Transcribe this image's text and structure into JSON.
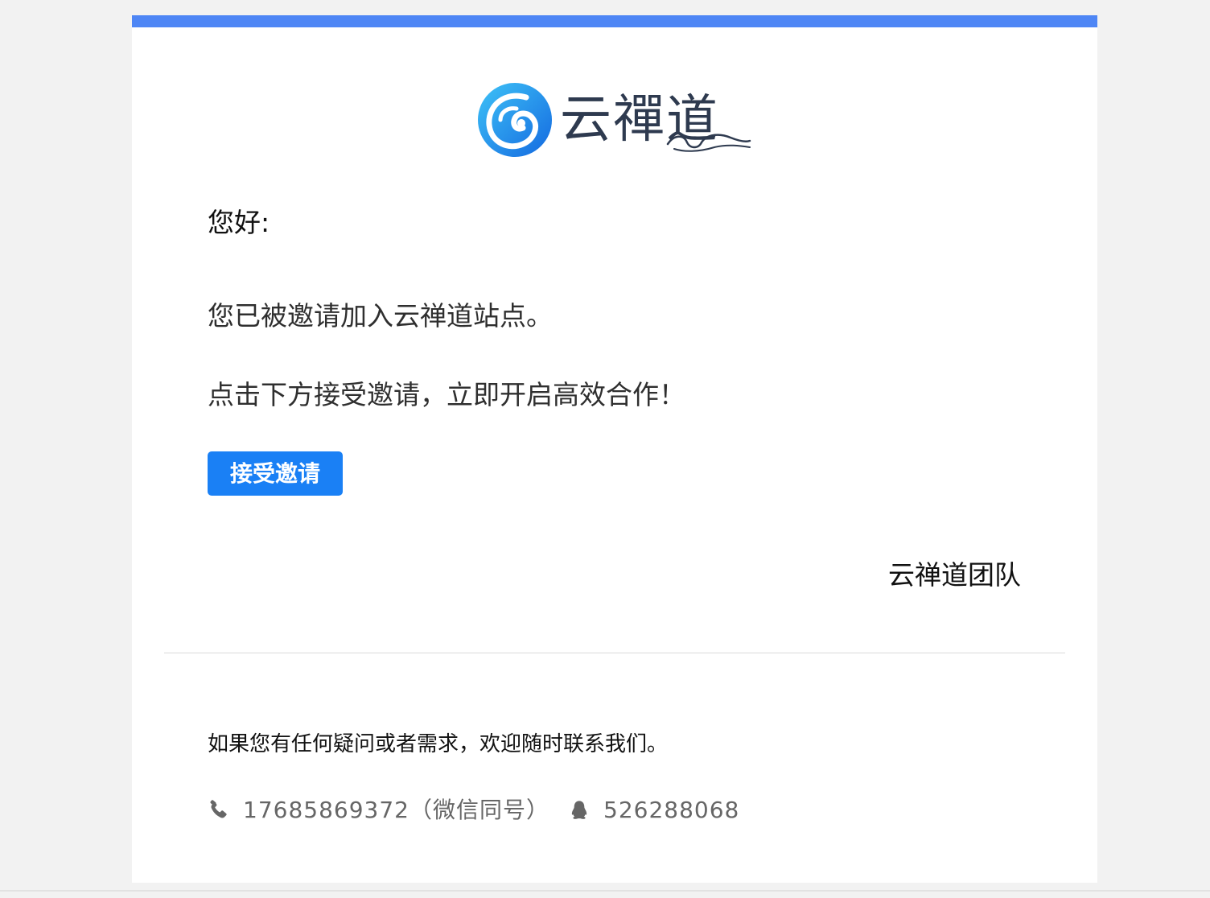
{
  "colors": {
    "accent_bar": "#4e86f5",
    "button": "#1a80f5",
    "logo_text": "#2e3a4f"
  },
  "logo": {
    "text": "云禪道",
    "icon": "yunchandao-logo-icon"
  },
  "email": {
    "greeting": "您好:",
    "message_line1": "您已被邀请加入云禅道站点。",
    "message_line2": "点击下方接受邀请，立即开启高效合作！",
    "accept_button_label": "接受邀请",
    "signature": "云禅道团队"
  },
  "footer": {
    "note": "如果您有任何疑问或者需求，欢迎随时联系我们。",
    "phone": {
      "icon": "phone-icon",
      "text": "17685869372（微信同号）"
    },
    "qq": {
      "icon": "qq-penguin-icon",
      "text": "526288068"
    }
  }
}
